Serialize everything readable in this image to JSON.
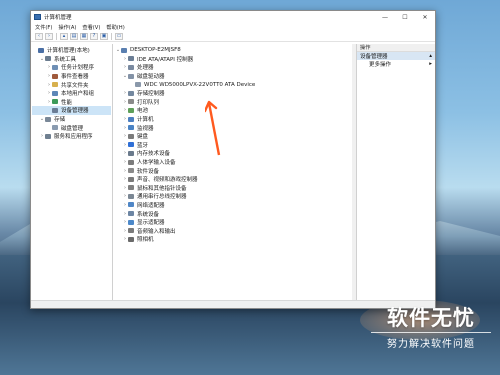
{
  "window": {
    "title": "计算机管理"
  },
  "window_controls": {
    "minimize": "—",
    "maximize": "☐",
    "close": "✕"
  },
  "menu": [
    "文件(F)",
    "操作(A)",
    "查看(V)",
    "帮助(H)"
  ],
  "left_tree": [
    {
      "label": "计算机管理(本地)",
      "indent": 0,
      "exp": "",
      "color": "#4a6fa5"
    },
    {
      "label": "系统工具",
      "indent": 1,
      "exp": "▾",
      "color": "#6b7c8f"
    },
    {
      "label": "任务计划程序",
      "indent": 2,
      "exp": "›",
      "color": "#6e8fb5"
    },
    {
      "label": "事件查看器",
      "indent": 2,
      "exp": "›",
      "color": "#a05a3c"
    },
    {
      "label": "共享文件夹",
      "indent": 2,
      "exp": "›",
      "color": "#d7b04e"
    },
    {
      "label": "本地用户和组",
      "indent": 2,
      "exp": "›",
      "color": "#5d87b8"
    },
    {
      "label": "性能",
      "indent": 2,
      "exp": "›",
      "color": "#3d9b5a"
    },
    {
      "label": "设备管理器",
      "indent": 2,
      "exp": "",
      "color": "#6a7d96",
      "selected": true
    },
    {
      "label": "存储",
      "indent": 1,
      "exp": "▾",
      "color": "#7a8898"
    },
    {
      "label": "磁盘管理",
      "indent": 2,
      "exp": "",
      "color": "#8a9bb0"
    },
    {
      "label": "服务和应用程序",
      "indent": 1,
      "exp": "›",
      "color": "#6f7f90"
    }
  ],
  "device_tree": [
    {
      "label": "DESKTOP-E2MJSF8",
      "indent": 0,
      "exp": "▾",
      "color": "#5a7fb0"
    },
    {
      "label": "IDE ATA/ATAPI 控制器",
      "indent": 1,
      "exp": "›",
      "color": "#6b7e95"
    },
    {
      "label": "处理器",
      "indent": 1,
      "exp": "›",
      "color": "#7a8aa0"
    },
    {
      "label": "磁盘驱动器",
      "indent": 1,
      "exp": "▾",
      "color": "#8392a6"
    },
    {
      "label": "WDC WD5000LPVX-22V0TT0 ATA Device",
      "indent": 2,
      "exp": "",
      "color": "#8a98aa"
    },
    {
      "label": "存储控制器",
      "indent": 1,
      "exp": "›",
      "color": "#74889f"
    },
    {
      "label": "打印队列",
      "indent": 1,
      "exp": "›",
      "color": "#8a8a8a"
    },
    {
      "label": "电池",
      "indent": 1,
      "exp": "›",
      "color": "#5fa05a"
    },
    {
      "label": "计算机",
      "indent": 1,
      "exp": "›",
      "color": "#4d7fc0"
    },
    {
      "label": "监视器",
      "indent": 1,
      "exp": "›",
      "color": "#4a83c4"
    },
    {
      "label": "键盘",
      "indent": 1,
      "exp": "›",
      "color": "#7b7b7b"
    },
    {
      "label": "蓝牙",
      "indent": 1,
      "exp": "›",
      "color": "#2f6fd6"
    },
    {
      "label": "内存技术设备",
      "indent": 1,
      "exp": "›",
      "color": "#6a7a8c"
    },
    {
      "label": "人体学输入设备",
      "indent": 1,
      "exp": "›",
      "color": "#7c7c7c"
    },
    {
      "label": "软件设备",
      "indent": 1,
      "exp": "›",
      "color": "#8a8a8a"
    },
    {
      "label": "声音、视频和游戏控制器",
      "indent": 1,
      "exp": "›",
      "color": "#7a7a7a"
    },
    {
      "label": "鼠标和其他指针设备",
      "indent": 1,
      "exp": "›",
      "color": "#808080"
    },
    {
      "label": "通用串行总线控制器",
      "indent": 1,
      "exp": "›",
      "color": "#7b8794"
    },
    {
      "label": "网络适配器",
      "indent": 1,
      "exp": "›",
      "color": "#4f86c6"
    },
    {
      "label": "系统设备",
      "indent": 1,
      "exp": "›",
      "color": "#6c85a3"
    },
    {
      "label": "显示适配器",
      "indent": 1,
      "exp": "›",
      "color": "#4c88c9"
    },
    {
      "label": "音频输入和输出",
      "indent": 1,
      "exp": "›",
      "color": "#7a7a7a"
    },
    {
      "label": "照相机",
      "indent": 1,
      "exp": "›",
      "color": "#6a6a6a"
    }
  ],
  "actions": {
    "header": "操作",
    "section": "设备管理器",
    "more": "更多操作"
  },
  "annotation": {
    "arrow_color": "#ff5a1f"
  },
  "watermark": {
    "title": "软件无忧",
    "subtitle": "努力解决软件问题"
  }
}
